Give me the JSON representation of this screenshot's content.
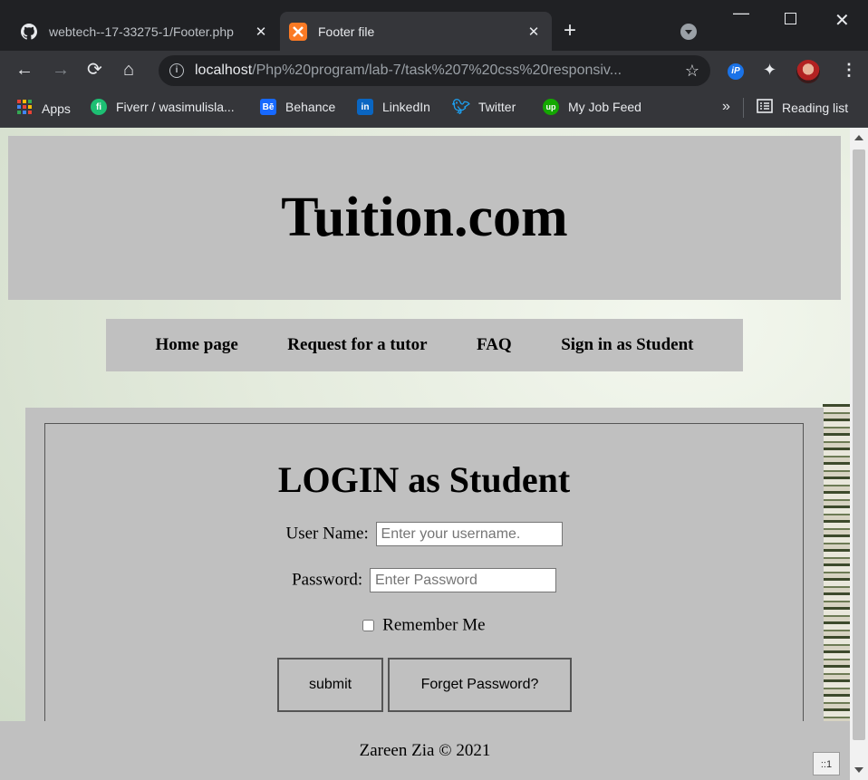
{
  "browser": {
    "tabs": [
      {
        "title": "webtech--17-33275-1/Footer.php",
        "icon": "github-icon",
        "active": false
      },
      {
        "title": "Footer file",
        "icon": "xampp-icon",
        "active": true
      }
    ],
    "new_tab_label": "+",
    "url_host": "localhost",
    "url_path": "/Php%20program/lab-7/task%207%20css%20responsiv...",
    "bookmarks": [
      {
        "label": "Apps",
        "icon": "apps-grid-icon"
      },
      {
        "label": "Fiverr / wasimulisla...",
        "icon": "fiverr-icon"
      },
      {
        "label": "Behance",
        "icon": "behance-icon"
      },
      {
        "label": "LinkedIn",
        "icon": "linkedin-icon"
      },
      {
        "label": "Twitter",
        "icon": "twitter-icon"
      },
      {
        "label": "My Job Feed",
        "icon": "upwork-icon"
      }
    ],
    "overflow_label": "»",
    "reading_list_label": "Reading list"
  },
  "page": {
    "site_title": "Tuition.com",
    "nav": [
      "Home page",
      "Request for a tutor",
      "FAQ",
      "Sign in as Student"
    ],
    "login": {
      "heading": "LOGIN as Student",
      "username_label": "User Name:",
      "username_placeholder": "Enter your username.",
      "password_label": "Password:",
      "password_placeholder": "Enter Password",
      "remember_label": "Remember Me",
      "remember_checked": false,
      "submit_label": "submit",
      "forget_label": "Forget Password?"
    },
    "footer_text": "Zareen Zia © 2021",
    "corner_badge": "::1"
  }
}
